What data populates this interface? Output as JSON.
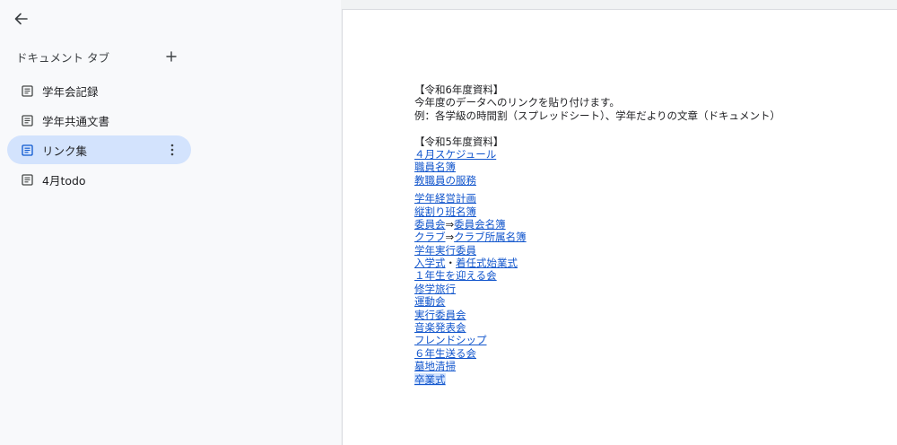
{
  "sidebar": {
    "tabs_header": "ドキュメント タブ",
    "tabs": [
      {
        "label": "学年会記録",
        "active": false
      },
      {
        "label": "学年共通文書",
        "active": false
      },
      {
        "label": "リンク集",
        "active": true
      },
      {
        "label": "4月todo",
        "active": false
      }
    ]
  },
  "document": {
    "r6_heading": "【令和6年度資料】",
    "r6_line1": "今年度のデータへのリンクを貼り付けます。",
    "r6_line2": "例：各学級の時間割（スプレッドシート）、学年だよりの文章（ドキュメント）",
    "r5_heading": "【令和5年度資料】",
    "group1": [
      "４月スケジュール",
      "職員名簿",
      "教職員の服務"
    ],
    "link_committee": "委員会",
    "arrow_committee": "⇒",
    "link_committee_list": "委員会名簿",
    "link_club": "クラブ",
    "arrow_club": "⇒",
    "link_club_list": "クラブ所属名簿",
    "link_entrance": "入学式",
    "sep_entrance": "・",
    "link_ceremony": "着任式始業式",
    "group2a": [
      "学年経営計画",
      "縦割り班名簿"
    ],
    "group2b": [
      "学年実行委員"
    ],
    "group2c": [
      "１年生を迎える会",
      "修学旅行",
      "運動会",
      "実行委員会",
      "音楽発表会",
      "フレンドシップ",
      "６年生送る会",
      "墓地清掃",
      "卒業式"
    ]
  }
}
